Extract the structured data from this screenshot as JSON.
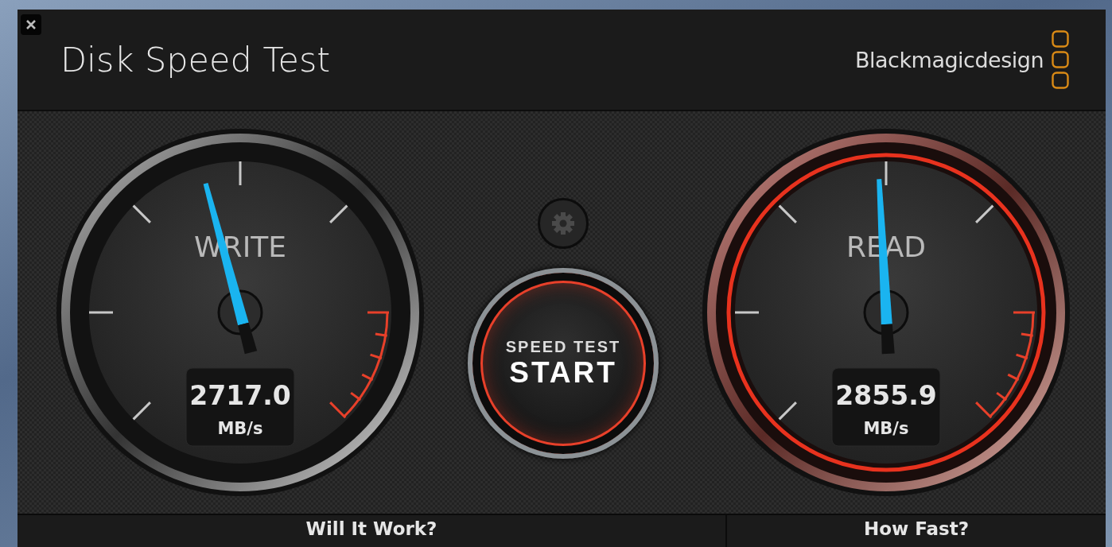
{
  "window": {
    "title": "Disk Speed Test",
    "brand": "Blackmagicdesign"
  },
  "gauges": [
    {
      "label": "WRITE",
      "value": "2717.0",
      "unit": "MB/s",
      "highlighted": false
    },
    {
      "label": "READ",
      "value": "2855.9",
      "unit": "MB/s",
      "highlighted": true
    }
  ],
  "start_button": {
    "caption": "SPEED TEST",
    "label": "START"
  },
  "tabs": [
    {
      "label": "Will It Work?",
      "selected": false
    },
    {
      "label": "How Fast?",
      "selected": false
    }
  ]
}
